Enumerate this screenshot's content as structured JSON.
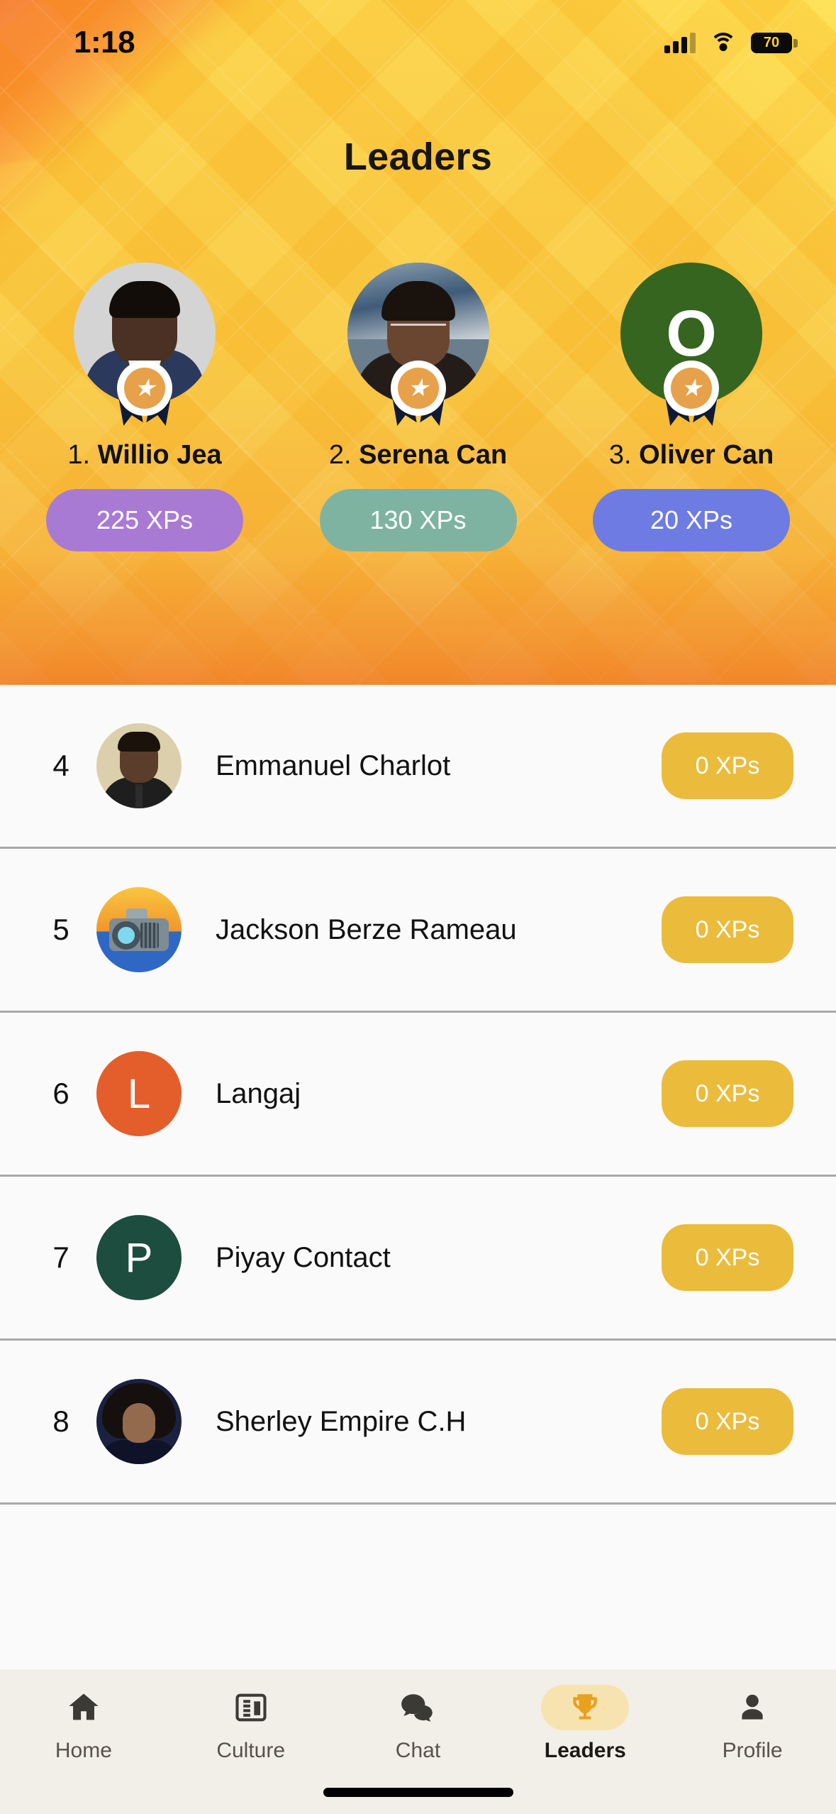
{
  "status_bar": {
    "time": "1:18",
    "battery_percent": "70",
    "signal_icon": "cellular-signal-icon",
    "wifi_icon": "wifi-icon",
    "battery_icon": "battery-icon"
  },
  "header": {
    "title": "Leaders"
  },
  "theme": {
    "hero_gradient_start": "#fcd23f",
    "hero_gradient_end": "#f5a93a",
    "list_background": "#fbfafb",
    "xp_pill_default": "#ebbb3c",
    "tabbar_background": "#f2efe9",
    "tab_active_pill": "#f7e3b0"
  },
  "podium": [
    {
      "rank": "1.",
      "name": "Willio Jea",
      "xp": "225 XPs",
      "xp_color": "#a87ad4",
      "avatar_type": "photo",
      "badge_icon": "star-medal-icon"
    },
    {
      "rank": "2.",
      "name": "Serena Can",
      "xp": "130 XPs",
      "xp_color": "#7fb3a1",
      "avatar_type": "photo",
      "badge_icon": "star-medal-icon"
    },
    {
      "rank": "3.",
      "name": "Oliver Can",
      "xp": "20 XPs",
      "xp_color": "#6d7be2",
      "avatar_type": "initial",
      "avatar_initial": "O",
      "avatar_color": "#35651f",
      "badge_icon": "star-medal-icon"
    }
  ],
  "list": [
    {
      "rank": "4",
      "name": "Emmanuel Charlot",
      "xp": "0 XPs",
      "avatar_type": "photo",
      "avatar_kind": "ph-emman"
    },
    {
      "rank": "5",
      "name": "Jackson Berze Rameau",
      "xp": "0 XPs",
      "avatar_type": "photo",
      "avatar_kind": "ph-cam"
    },
    {
      "rank": "6",
      "name": "Langaj",
      "xp": "0 XPs",
      "avatar_type": "initial",
      "avatar_initial": "L",
      "avatar_color": "#e45e2b"
    },
    {
      "rank": "7",
      "name": "Piyay Contact",
      "xp": "0 XPs",
      "avatar_type": "initial",
      "avatar_initial": "P",
      "avatar_color": "#1d4d3e"
    },
    {
      "rank": "8",
      "name": "Sherley Empire C.H",
      "xp": "0 XPs",
      "avatar_type": "photo",
      "avatar_kind": "ph-sherley"
    }
  ],
  "tabbar": [
    {
      "label": "Home",
      "icon": "home-icon",
      "active": false
    },
    {
      "label": "Culture",
      "icon": "news-icon",
      "active": false
    },
    {
      "label": "Chat",
      "icon": "chat-icon",
      "active": false
    },
    {
      "label": "Leaders",
      "icon": "trophy-icon",
      "active": true
    },
    {
      "label": "Profile",
      "icon": "person-icon",
      "active": false
    }
  ]
}
